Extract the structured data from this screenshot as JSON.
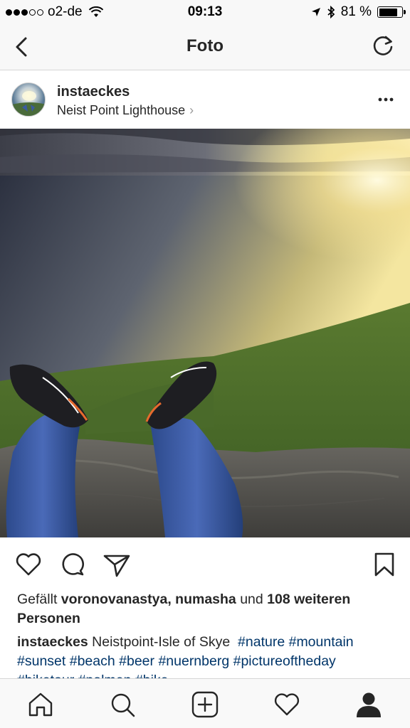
{
  "status_bar": {
    "carrier": "o2-de",
    "time": "09:13",
    "battery": "81 %",
    "battery_level": 0.81
  },
  "nav": {
    "title": "Foto"
  },
  "post": {
    "username": "instaeckes",
    "location": "Neist Point Lighthouse",
    "likes": {
      "prefix": "Gefällt",
      "users": "voronovanastya, numasha",
      "connector": "und",
      "count_text": "108 weiteren",
      "suffix": "Personen"
    },
    "caption": {
      "author": "instaeckes",
      "text": "Neistpoint-Isle of Skye",
      "hashtags": [
        "#nature",
        "#mountain",
        "#sunset",
        "#beach",
        "#beer",
        "#nuernberg",
        "#pictureoftheday",
        "#biketour",
        "#palmen",
        "#bike"
      ]
    }
  },
  "icons": {
    "back": "chevron-left-icon",
    "refresh": "refresh-icon",
    "more": "more-dots-icon",
    "like": "heart-icon",
    "comment": "comment-icon",
    "share": "send-icon",
    "save": "bookmark-icon",
    "tabs": [
      "home-icon",
      "search-icon",
      "add-post-icon",
      "activity-heart-icon",
      "profile-icon"
    ]
  }
}
